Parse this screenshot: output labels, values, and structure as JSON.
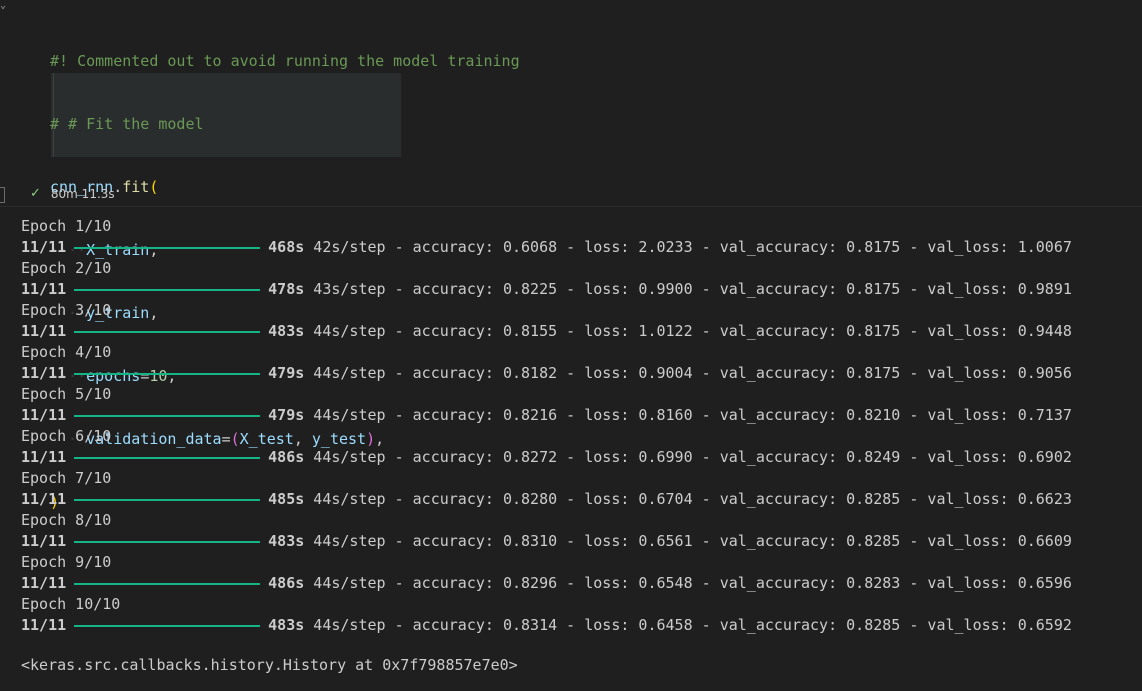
{
  "code": {
    "line1": "#! Commented out to avoid running the model training",
    "line2": "# # Fit the model",
    "line3_obj": "cnn_rnn",
    "line3_fn": "fit",
    "arg1": "X_train",
    "arg2": "y_train",
    "arg3_name": "epochs",
    "arg3_val": "10",
    "arg4_name": "validation_data",
    "arg4_a": "X_test",
    "arg4_b": "y_test",
    "close": ")"
  },
  "status": {
    "duration": "80m 11.3s"
  },
  "epochs": [
    {
      "label": "Epoch 1/10",
      "steps": "11/11",
      "time": "468s",
      "per_step": "42s/step",
      "metrics": "- accuracy: 0.6068 - loss: 2.0233 - val_accuracy: 0.8175 - val_loss: 1.0067"
    },
    {
      "label": "Epoch 2/10",
      "steps": "11/11",
      "time": "478s",
      "per_step": "43s/step",
      "metrics": "- accuracy: 0.8225 - loss: 0.9900 - val_accuracy: 0.8175 - val_loss: 0.9891"
    },
    {
      "label": "Epoch 3/10",
      "steps": "11/11",
      "time": "483s",
      "per_step": "44s/step",
      "metrics": "- accuracy: 0.8155 - loss: 1.0122 - val_accuracy: 0.8175 - val_loss: 0.9448"
    },
    {
      "label": "Epoch 4/10",
      "steps": "11/11",
      "time": "479s",
      "per_step": "44s/step",
      "metrics": "- accuracy: 0.8182 - loss: 0.9004 - val_accuracy: 0.8175 - val_loss: 0.9056"
    },
    {
      "label": "Epoch 5/10",
      "steps": "11/11",
      "time": "479s",
      "per_step": "44s/step",
      "metrics": "- accuracy: 0.8216 - loss: 0.8160 - val_accuracy: 0.8210 - val_loss: 0.7137"
    },
    {
      "label": "Epoch 6/10",
      "steps": "11/11",
      "time": "486s",
      "per_step": "44s/step",
      "metrics": "- accuracy: 0.8272 - loss: 0.6990 - val_accuracy: 0.8249 - val_loss: 0.6902"
    },
    {
      "label": "Epoch 7/10",
      "steps": "11/11",
      "time": "485s",
      "per_step": "44s/step",
      "metrics": "- accuracy: 0.8280 - loss: 0.6704 - val_accuracy: 0.8285 - val_loss: 0.6623"
    },
    {
      "label": "Epoch 8/10",
      "steps": "11/11",
      "time": "483s",
      "per_step": "44s/step",
      "metrics": "- accuracy: 0.8310 - loss: 0.6561 - val_accuracy: 0.8285 - val_loss: 0.6609"
    },
    {
      "label": "Epoch 9/10",
      "steps": "11/11",
      "time": "486s",
      "per_step": "44s/step",
      "metrics": "- accuracy: 0.8296 - loss: 0.6548 - val_accuracy: 0.8283 - val_loss: 0.6596"
    },
    {
      "label": "Epoch 10/10",
      "steps": "11/11",
      "time": "483s",
      "per_step": "44s/step",
      "metrics": "- accuracy: 0.8314 - loss: 0.6458 - val_accuracy: 0.8285 - val_loss: 0.6592"
    }
  ],
  "result": "<keras.src.callbacks.history.History at 0x7f798857e7e0>",
  "colors": {
    "progress_bar": "#15b385",
    "success_check": "#89d185",
    "comment": "#6a9955"
  },
  "icons": {
    "collapse": "chevron-down-icon",
    "status": "check-icon"
  }
}
